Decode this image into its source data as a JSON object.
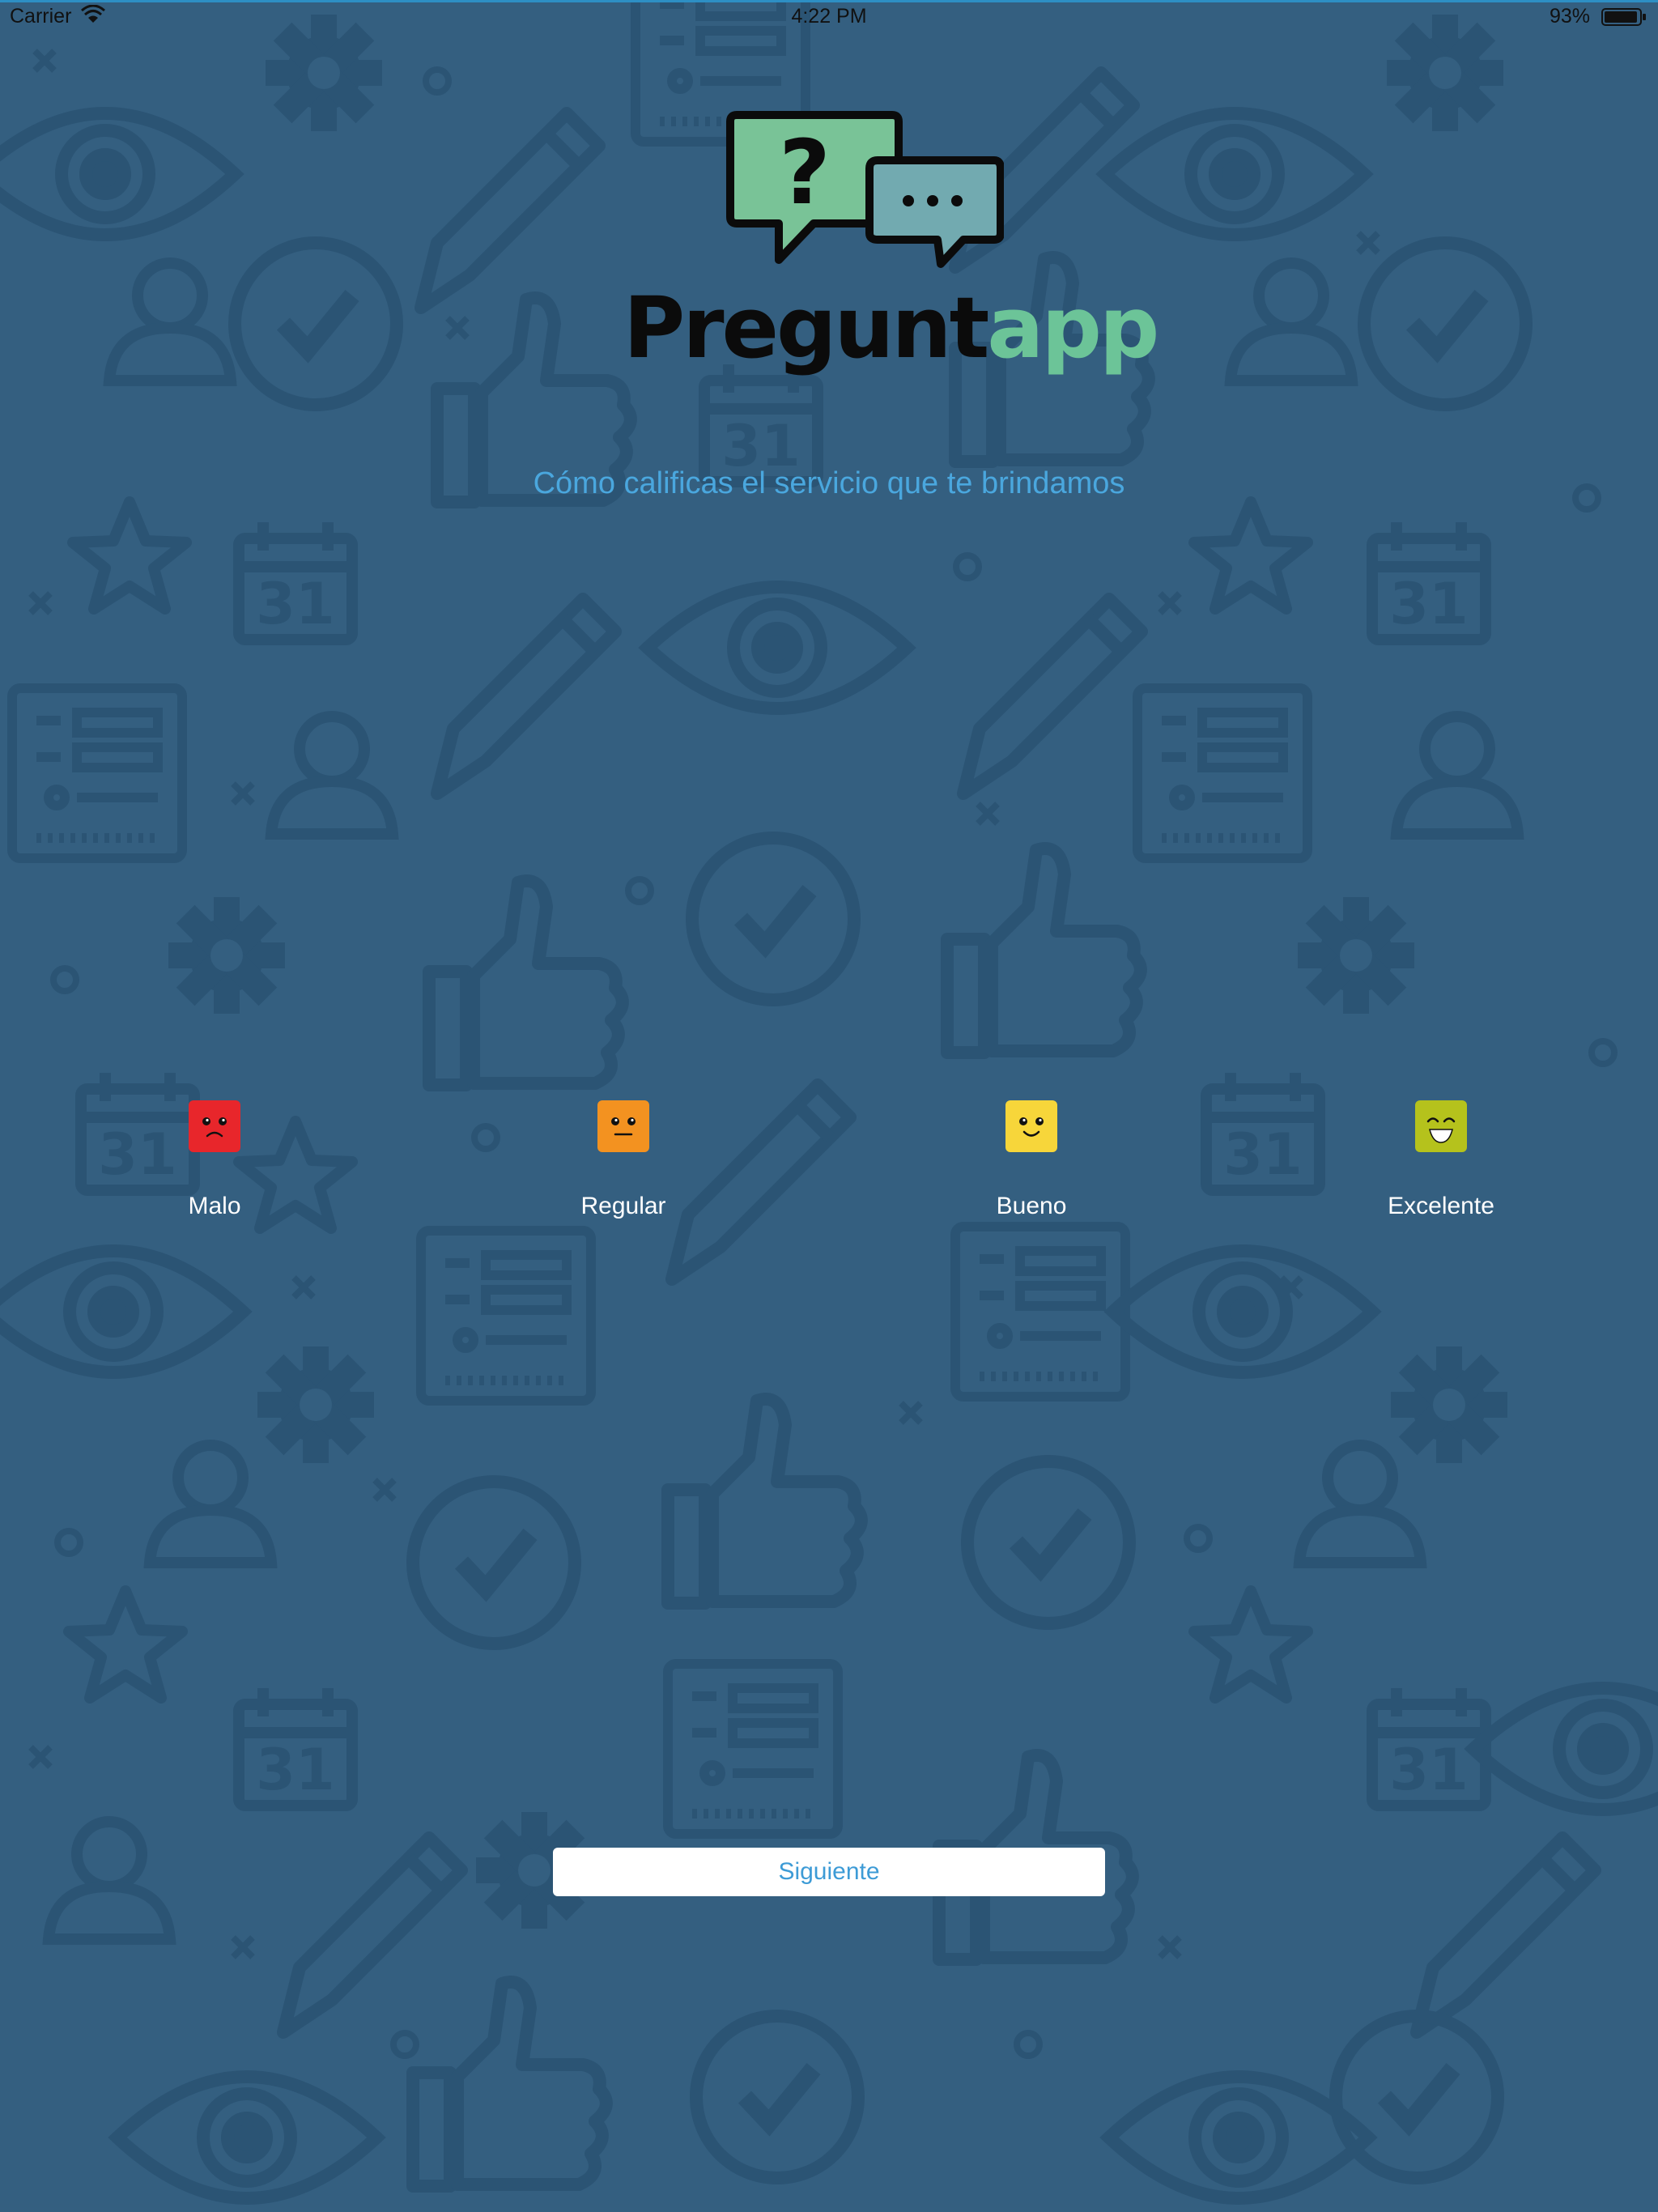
{
  "status_bar": {
    "carrier": "Carrier",
    "time": "4:22 PM",
    "battery": "93%",
    "wifi_icon": "wifi-icon",
    "battery_icon": "battery-icon"
  },
  "logo": {
    "icon": "speech-bubbles-question-icon",
    "text_part1": "Pregunt",
    "text_part2": "app",
    "color_part1": "#0b0b0b",
    "color_part2": "#6cc498"
  },
  "survey": {
    "question": "Cómo calificas el servicio que te brindamos",
    "options": [
      {
        "label": "Malo",
        "icon": "angry-face-icon",
        "color": "#e8262b"
      },
      {
        "label": "Regular",
        "icon": "neutral-face-icon",
        "color": "#f39220"
      },
      {
        "label": "Bueno",
        "icon": "smile-face-icon",
        "color": "#f7d63a"
      },
      {
        "label": "Excelente",
        "icon": "grin-face-icon",
        "color": "#b5c21c"
      }
    ]
  },
  "next_button": {
    "label": "Siguiente"
  },
  "colors": {
    "background": "#345f80",
    "pattern": "#2b5474",
    "accent": "#4aa7de"
  }
}
